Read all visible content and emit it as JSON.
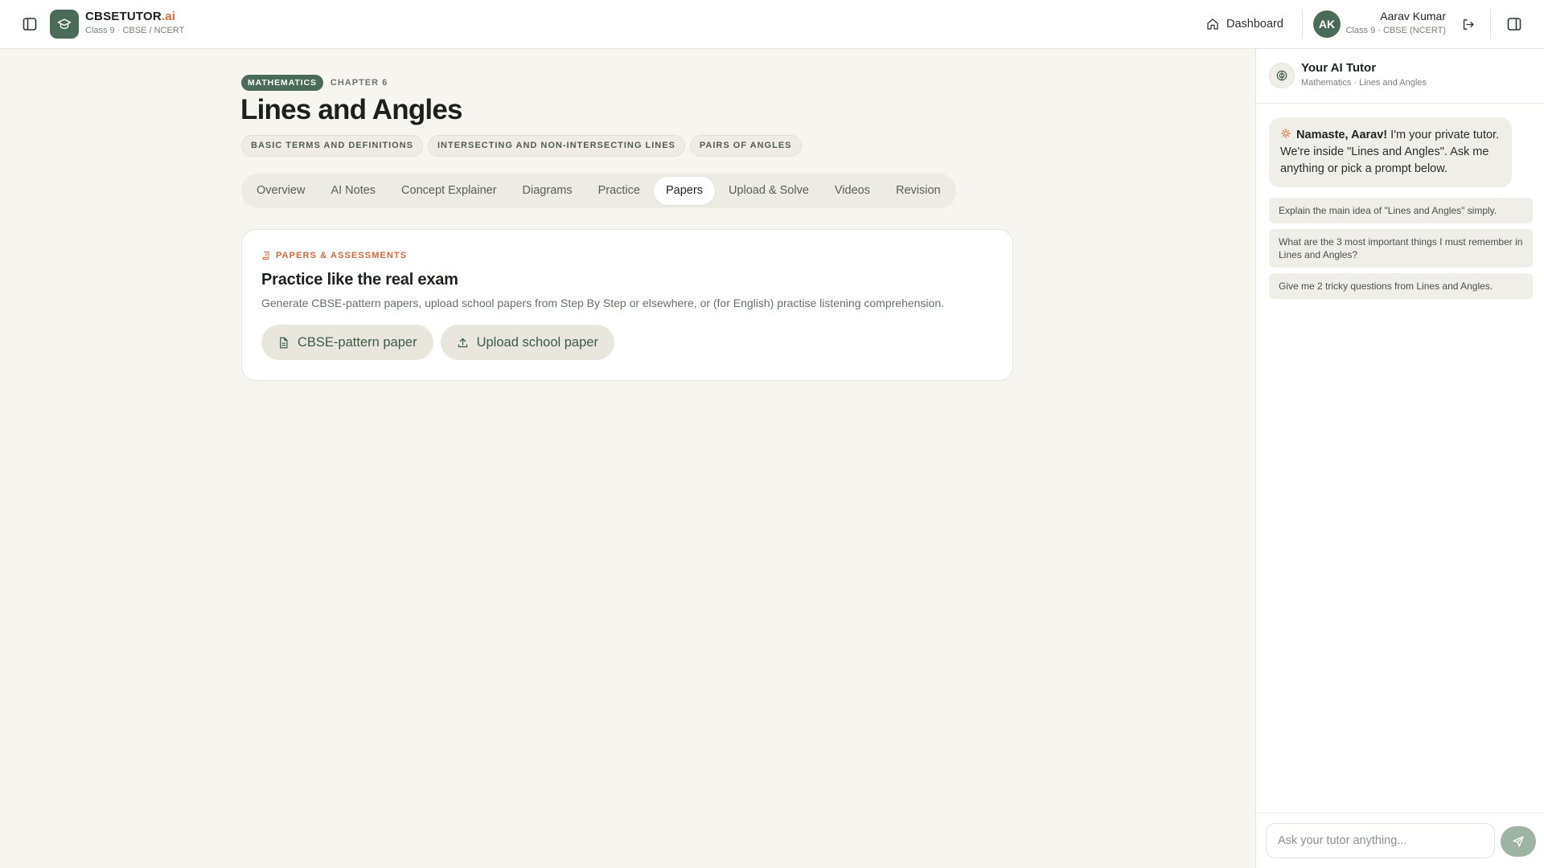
{
  "header": {
    "brand_name": "CBSETUTOR",
    "brand_suffix": ".ai",
    "brand_sub": "Class 9 · CBSE / NCERT",
    "dashboard_label": "Dashboard",
    "user_initials": "AK",
    "user_name": "Aarav Kumar",
    "user_sub": "Class 9 · CBSE (NCERT)"
  },
  "chapter": {
    "subject": "MATHEMATICS",
    "chapter_label": "CHAPTER 6",
    "title": "Lines and Angles",
    "topics": [
      "BASIC TERMS AND DEFINITIONS",
      "INTERSECTING AND NON-INTERSECTING LINES",
      "PAIRS OF ANGLES"
    ]
  },
  "tabs": [
    {
      "label": "Overview"
    },
    {
      "label": "AI Notes"
    },
    {
      "label": "Concept Explainer"
    },
    {
      "label": "Diagrams"
    },
    {
      "label": "Practice"
    },
    {
      "label": "Papers",
      "active": true
    },
    {
      "label": "Upload & Solve"
    },
    {
      "label": "Videos"
    },
    {
      "label": "Revision"
    }
  ],
  "papers_card": {
    "kicker": "PAPERS & ASSESSMENTS",
    "title": "Practice like the real exam",
    "description": "Generate CBSE-pattern papers, upload school papers from Step By Step or elsewhere, or (for English) practise listening comprehension.",
    "buttons": [
      "CBSE-pattern paper",
      "Upload school paper"
    ]
  },
  "tutor": {
    "title": "Your AI Tutor",
    "subtitle": "Mathematics · Lines and Angles",
    "greeting_bold": "Namaste, Aarav!",
    "greeting_rest": " I'm your private tutor. We're inside \"Lines and Angles\". Ask me anything or pick a prompt below.",
    "prompts": [
      "Explain the main idea of \"Lines and Angles\" simply.",
      "What are the 3 most important things I must remember in Lines and Angles?",
      "Give me 2 tricky questions from Lines and Angles."
    ],
    "input_placeholder": "Ask your tutor anything..."
  },
  "colors": {
    "accent_green": "#4a6b58",
    "accent_orange": "#d96a3b",
    "background": "#f6f5f0"
  }
}
